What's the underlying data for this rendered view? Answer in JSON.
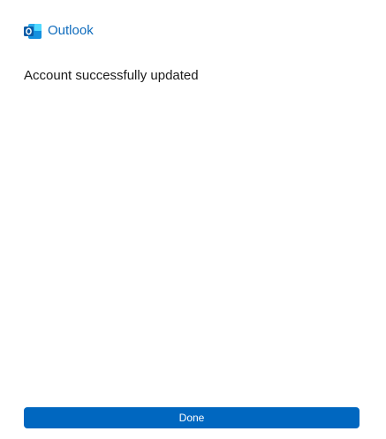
{
  "app": {
    "name": "Outlook",
    "icon": "outlook-icon",
    "brand_color": "#0f6cbd"
  },
  "status": {
    "title": "Account successfully updated"
  },
  "actions": {
    "done_label": "Done",
    "button_color": "#0067c0"
  }
}
